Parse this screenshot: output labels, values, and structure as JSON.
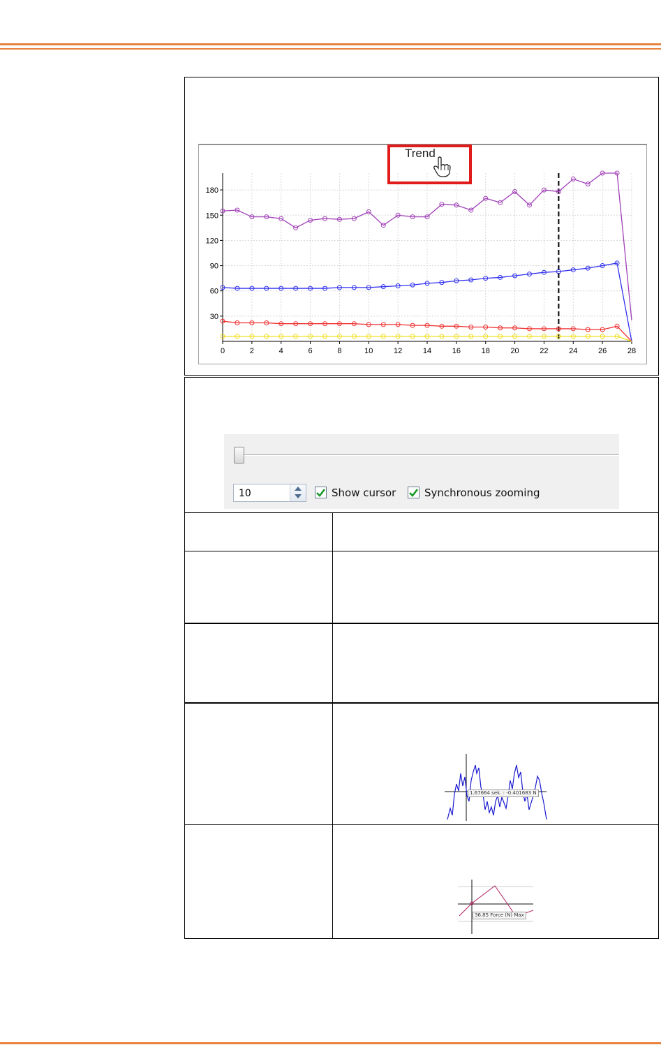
{
  "trend_tab": {
    "label": "Trend"
  },
  "chart_data": {
    "type": "line",
    "x": [
      0,
      1,
      2,
      3,
      4,
      5,
      6,
      7,
      8,
      9,
      10,
      11,
      12,
      13,
      14,
      15,
      16,
      17,
      18,
      19,
      20,
      21,
      22,
      23,
      24,
      25,
      26,
      27,
      28
    ],
    "xticks": [
      0,
      2,
      4,
      6,
      8,
      10,
      12,
      14,
      16,
      18,
      20,
      22,
      24,
      26,
      28
    ],
    "yticks": [
      30,
      60,
      90,
      120,
      150,
      180
    ],
    "xlim": [
      0,
      28
    ],
    "ylim": [
      0,
      200
    ],
    "grid": true,
    "cursor_x": 23,
    "series": [
      {
        "color": "#a040b8",
        "values": [
          155,
          156,
          148,
          148,
          146,
          135,
          144,
          146,
          145,
          146,
          154,
          138,
          150,
          148,
          148,
          163,
          162,
          156,
          170,
          165,
          178,
          162,
          180,
          178,
          193,
          187,
          200,
          200,
          25
        ]
      },
      {
        "color": "#3030f0",
        "values": [
          64,
          63,
          63,
          63,
          63,
          63,
          63,
          63,
          64,
          64,
          64,
          65,
          66,
          67,
          69,
          70,
          72,
          73,
          75,
          76,
          78,
          80,
          82,
          83,
          85,
          87,
          90,
          93,
          0
        ]
      },
      {
        "color": "#f03030",
        "values": [
          24,
          22,
          22,
          22,
          21,
          21,
          21,
          21,
          21,
          21,
          20,
          20,
          20,
          19,
          19,
          18,
          18,
          17,
          17,
          16,
          16,
          15,
          15,
          15,
          15,
          14,
          14,
          18,
          0
        ]
      },
      {
        "color": "#f0e020",
        "values": [
          6,
          6,
          6,
          6,
          6,
          6,
          6,
          6,
          6,
          6,
          6,
          6,
          6,
          6,
          6,
          6,
          6,
          6,
          6,
          6,
          6,
          6,
          6,
          6,
          6,
          6,
          6,
          6,
          0
        ]
      }
    ]
  },
  "controls": {
    "slider_value": 0,
    "spin_value": "10",
    "show_cursor_label": "Show cursor",
    "show_cursor_checked": true,
    "sync_zoom_label": "Synchronous zooming",
    "sync_zoom_checked": true
  },
  "examples": {
    "cursor_tooltip": "1.67664 sek. : -0.401683 N",
    "marker_tooltip": "36.85 Force (N) Max"
  }
}
